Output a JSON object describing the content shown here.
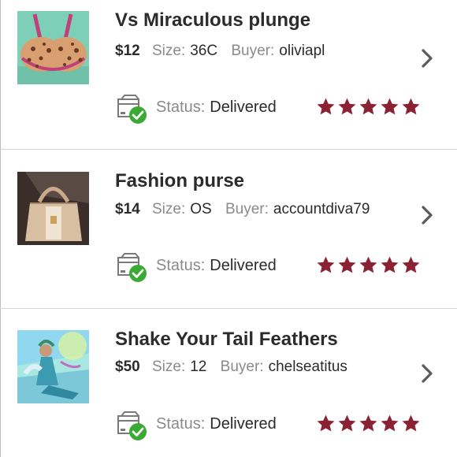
{
  "colors": {
    "star": "#8b2233",
    "check": "#3aaa35",
    "chevron": "#5a5a5a"
  },
  "labels": {
    "size": "Size:",
    "buyer": "Buyer:",
    "status": "Status:"
  },
  "orders": [
    {
      "title": "Vs Miraculous plunge",
      "price": "$12",
      "size": "36C",
      "buyer": "oliviapl",
      "status": "Delivered",
      "rating": 5,
      "thumb_icon": "leopard-bra-photo"
    },
    {
      "title": "Fashion purse",
      "price": "$14",
      "size": "OS",
      "buyer": "accountdiva79",
      "status": "Delivered",
      "rating": 5,
      "thumb_icon": "handbag-photo"
    },
    {
      "title": "Shake Your Tail Feathers",
      "price": "$50",
      "size": "12",
      "buyer": "chelseatitus",
      "status": "Delivered",
      "rating": 5,
      "thumb_icon": "costume-doll-photo"
    }
  ]
}
